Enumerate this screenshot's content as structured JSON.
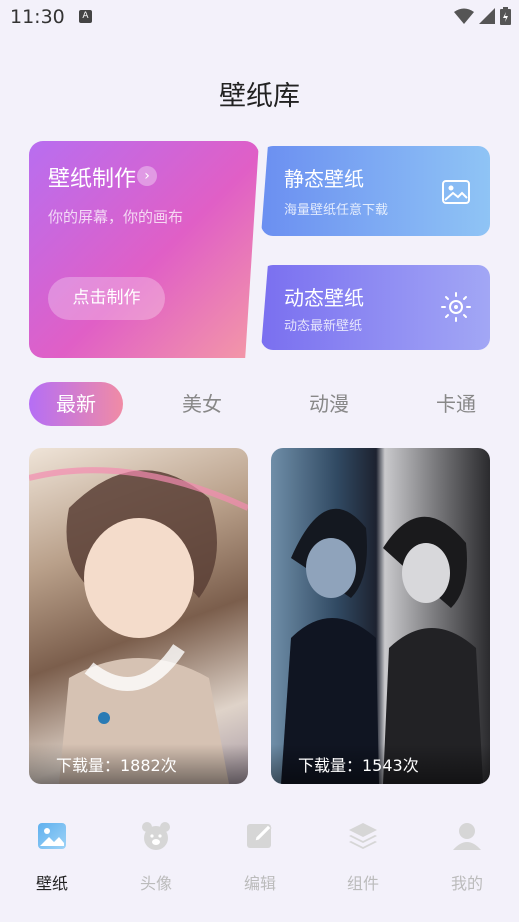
{
  "status_bar": {
    "time": "11:30",
    "notif_icon": "A"
  },
  "page_title": "壁纸库",
  "make_card": {
    "title": "壁纸制作",
    "subtitle": "你的屏幕，你的画布",
    "button": "点击制作"
  },
  "static_card": {
    "title": "静态壁纸",
    "subtitle": "海量壁纸任意下载",
    "icon": "image-icon"
  },
  "dynamic_card": {
    "title": "动态壁纸",
    "subtitle": "动态最新壁纸",
    "icon": "sparkle-icon"
  },
  "tabs": [
    {
      "label": "最新",
      "active": true
    },
    {
      "label": "美女",
      "active": false
    },
    {
      "label": "动漫",
      "active": false
    },
    {
      "label": "卡通",
      "active": false
    }
  ],
  "wallpapers": [
    {
      "downloads": "下载量：1882次"
    },
    {
      "downloads": "下载量：1543次"
    }
  ],
  "nav": [
    {
      "label": "壁纸",
      "icon": "wallpaper-icon",
      "active": true
    },
    {
      "label": "头像",
      "icon": "bear-icon",
      "active": false
    },
    {
      "label": "编辑",
      "icon": "edit-icon",
      "active": false
    },
    {
      "label": "组件",
      "icon": "layers-icon",
      "active": false
    },
    {
      "label": "我的",
      "icon": "user-icon",
      "active": false
    }
  ],
  "colors": {
    "accent_start": "#b56ef5",
    "accent_end": "#f08ba5",
    "background": "#f3f1fa"
  }
}
